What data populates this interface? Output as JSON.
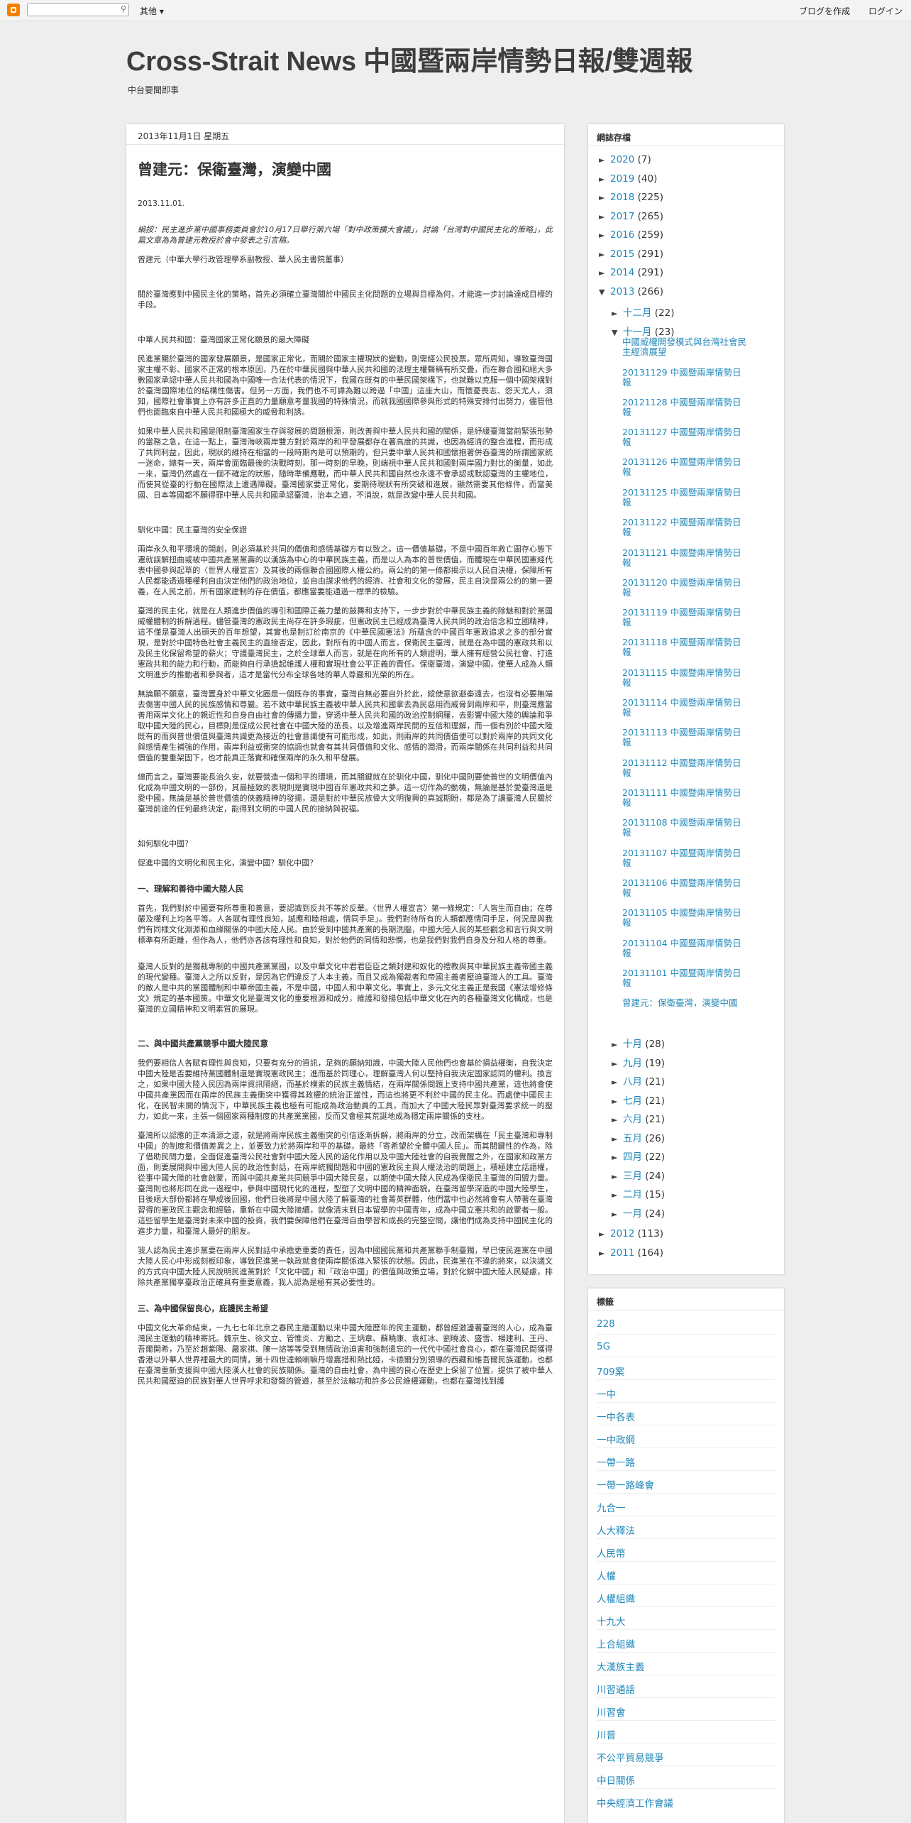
{
  "navbar": {
    "more": "其他 ▾",
    "create_blog": "ブログを作成",
    "login": "ログイン"
  },
  "header": {
    "title": "Cross-Strait News 中國暨兩岸情勢日報/雙週報",
    "description": "中台要聞即事"
  },
  "post": {
    "date": "2013年11月1日 星期五",
    "title": "曾建元：保衛臺灣，演變中國",
    "pub_date": "2013.11.01.",
    "editor_note": "編按：民主進步黨中國事務委員會於10月17日舉行第六場「對中政策擴大會議」，討論「台灣對中國民主化的策略」，此篇文章為為曾建元教授於會中發表之引言稿。",
    "author": "曾建元（中華大學行政管理學系副教授、華人民主書院董事）",
    "p_intro": "關於臺灣應對中國民主化的策略，首先必須確立臺灣關於中國民主化問題的立場與目標為何，才能進一步討論達成目標的手段。",
    "h_zhongha": "中華人民共和國：臺灣國家正常化願景的最大障礙",
    "p1": "民進黨關於臺灣的國家發展願景，是國家正常化，而關於國家主權現狀的變動，則需經公民投票。眾所周知，導致臺灣國家主權不彰、國家不正常的根本原因，乃在於中華民國與中華人民共和國的法理主權聲稱有所交疊，而在聯合國和絕大多數國家承認中華人民共和國為中國唯一合法代表的情況下，我國在既有的中華民國架構下，也就難以克服一個中國架構對於臺灣國際地位的結構性傷害。但另一方面，我們也不可諱為難以跨過「中國」這座大山，而懷憂喪志、怨天尤人，須知，國際社會事實上亦有許多正直的力量願意考量我國的特殊情況，而就我國國際參與形式的特殊安排付出努力，儘管他們也面臨來自中華人民共和國極大的威脅和利誘。",
    "p2": "如果中華人民共和國是限制臺灣國家生存與發展的問題根源，則改善與中華人民共和國的關係，是紓緩臺灣當前緊張形勢的當務之急，在這一點上，臺灣海峽兩岸雙方對於兩岸的和平發展都存在著高度的共識，也因為經濟的整合進程，而形成了共同利益，因此，現狀的維持在相當的一段時期內是可以預期的，但只要中華人民共和國懷抱著併吞臺灣的所謂國家統一迷命，總有一天，兩岸會面臨最後的決戰時刻，那一時刻的早晚，則端視中華人民共和國對兩岸國力對比的衡量，如此一來，臺灣仍然處在一個不確定的狀態，隨時準備應戰，而中華人民共和國自然也永遠不會承認或默認臺灣的主權地位，而使其從臺的行動在國際法上遭遇障礙。臺灣國家要正常化，要期待現狀有所突破和進展，顯然需要其他條件，而當美國、日本等國都不願得罪中華人民共和國承認臺灣，治本之道，不消說，就是改變中華人民共和國。",
    "h_tame": "馴化中國：民主臺灣的安全保證",
    "p3": "兩岸永久和平環境的開創，則必須基於共同的價值和感情基礎方有以致之。這一價值基礎，不是中國百年救亡圖存心態下遷就誤解扭曲或被中國共產黨黨壽的以漢族為中心的中華民族主義，而是以人為本的普世價值，而體現在中華民國憲經代表中國參與起草的〈世界人權宣言〉及其後的兩個聯合國國際人權公約。兩公約的第一條都揭示以人民自決權，保障所有人民都能透過種權利自由決定他們的政治地位，並自由謀求他們的經濟、社會和文化的發展，民主自決是兩公約的第一要義，在人民之前，所有國家建制的存在價值，都應當要能通過一標準的檢驗。",
    "p4": "臺灣的民主化，就是在人類進步價值的導引和國際正義力量的鼓舞和支持下，一步步對於中華民族主義的除魅和對於黨國威權體制的拆解過程。儘管臺灣的憲政民主尚存在許多瑕疵，但憲政民主已經成為臺灣人民共同的政治信念和立國精神，這不僅是臺灣人出頭天的百年想望，其實也是制訂於南京的《中華民國憲法》所蘊含的中國百年憲政追求之多的部分實現，是對於中國特色社會主義民主的直接否定，因此，對所有的中國人而言，保衛民主臺灣，就是在為中國的憲政共和以及民主化保留希望的薪火；守護臺灣民主，之於全球華人而言，就是在向所有的人類證明，華人擁有經營公民社會、打造憲政共和的能力和行動，而能夠自行承擔起維護人權和實現社會公平正義的責任。保衛臺灣，演變中國，使華人成為人類文明進步的推動者和參與者，這才是當代分布全球各地的華人尊嚴和光榮的所在。",
    "p5": "無論願不願意，臺灣置身於中華文化圈是一個既存的事實，臺灣自無必要自外於此，縱使意欲避秦遠去，也沒有必要無端去傷害中國人民的民族感情和尊嚴。若不致中華民族主義被中華人民共和國拿去為民惡用而威脅到兩岸和平，則臺灣應當善用兩岸文化上的親近性和自身自由社會的傳播力量，穿透中華人民共和國的政治控制網羅，去影響中國大陸的輿論和爭取中國大陸的民心，目標則是促成公民社會在中國大陸的茁長，以及增進兩岸民間的互信和理解，而一個有別於中國大陸既有的而與普世價值與臺灣共識更為接近的社會意識便有可能形成，如此，則兩岸的共同價值便可以對於兩岸的共同文化與感情產生補強的作用，兩岸利益或衝突的協調也就會有其共同價值和文化、感情的潤滑，而兩岸關係在共同利益和共同價值的雙重架固下，也才能真正落實和確保兩岸的永久和平發展。",
    "p6": "總而言之，臺灣要能長治久安，就要營造一個和平的環境，而其關鍵就在於馴化中國，馴化中國則要使普世的文明價值內化成為中國文明的一部份，其最極致的表現則是實現中國百年憲政共和之夢。這一切作為的動機，無論是基於愛臺灣還是愛中國，無論是基於普世價值的俠義精神的發揚，還是對於中華民族偉大文明復興的真誠期盼，都是為了讓臺灣人民關於臺灣前途的任何最終決定，能得到文明的中國人民的接納與祝福。",
    "h_how": "如何馴化中國？",
    "q_how": "促進中國的文明化和民主化，演變中國？馴化中國？",
    "h_one": "一、理解和善待中國大陸人民",
    "p7": "首先，我們對於中國要有所尊重和善意，要認識到反共不等於反華。〈世界人權宣言〉第一條規定：「人皆生而自由；在尊嚴及權利上均各平等。人各賦有理性良知，誠應和睦相處，情同手足」。我們對待所有的人類都應情同手足，何況是與我們有同樣文化淵源和血緣關係的中國大陸人民。由於受到中國共產黨的長期洗腦，中國大陸人民的某些觀念和言行與文明標準有所距離，但作為人，他們亦各該有理性和良知，對於他們的同情和悲憫，也是我們對我們自身及分和人格的尊重。",
    "p8": "臺灣人反對的是獨裁專制的中國共產黨黨國，以及中華文化中君君臣臣之類封建和奴化的禮教與其中華民族主義帝國主義的現代變種。臺灣人之所以反對，是因為它們違反了人本主義，而且又成為獨裁者和帝國主義者壓迫臺灣人的工具。臺灣的敵人是中共的黨國體制和中華帝國主義，不是中國，中國人和中華文化。事實上，多元文化主義正是我國《憲法增修條文》規定的基本國策。中華文化是臺灣文化的重要根源和成分，維護和發揚包括中華文化在內的各種臺灣文化構成，也是臺灣的立國精神和文明素質的展現。",
    "h_two": "二、與中國共產黨競爭中國大陸民意",
    "p9": "我們要相信人各賦有理性與良知，只要有充分的資訊，足夠的願納知識，中國大陸人民他們也會基於損益權衡，自我決定中國大陸是否要維持黨國體制還是實現憲政民主；進而基於同理心，理解臺灣人何以堅持自我決定國家認同的權利。換言之，如果中國大陸人民因為兩岸資訊隔絕，而基於樸素的民族主義情結，在兩岸關係問題上支持中國共產黨，這也將會使中國共產黨因而在兩岸的民族主義衝突中獲得其政權的統治正當性，而這也將更不利於中國的民主化。而處使中國民主化，在民智未開的情況下，中華民族主義也極有可能成為政治動員的工具，而加大了中國大陸民眾對臺灣要求統一的壓力，如此一來，主張一個國家兩種制度的共產黨黨國，反而又會極其荒誕地成為穩定兩岸關係的支柱。",
    "p10": "臺灣所以認應的正本清源之道，就是將兩岸民族主義衝突的引信逐漸拆解，將兩岸的分立，改而架構在「民主臺灣和專制中國」的制度和價值差異之上，並要致力於將兩岸和平的基礎，最終「寄希望於全體中國人民」。而其關鍵性的作為，除了借助民間力量，全面促進臺灣公民社會對中國大陸人民的涵化作用以及中國大陸社會的自我覺醒之外，在國家和政黨方面，則要展開與中國大陸人民的政治性對話，在兩岸統獨問題和中國的憲政民主與人權法治的問題上，積極建立話語權，從事中國大陸的社會啟蒙，而與中國共產黨共同競爭中國大陸民意，以期使中國大陸人民成為保衛民主臺灣的同盟力量。臺灣則也將形同在此一過程中，參與中國現代化的進程，型塑了文明中國的精神面貌。在臺灣留學深造的中國大陸學生，日後絕大部份都將在學成後回國，他們日後將是中國大陸了解臺灣的社會菁英群體，他們當中也必然將會有人帶著在臺灣習得的憲政民主觀念和經驗，重新在中國大陸接續，就像清末到日本留學的中國青年，成為中國立憲共和的啟蒙者一般。這些留學生是臺灣對未來中國的投資，我們要保障他們在臺灣自由學習和成長的完整空間，讓他們成為支持中國民主化的進步力量，和臺灣人最好的朋友。",
    "p11": "我人認為民主進步黨要在兩岸人民對話中承擔更重要的責任，因為中國國民黨和共產黨聯手制臺獨，早已使民進黨在中國大陸人民心中形成刻板印象，導致民進黨一執政就會使兩岸關係進入緊張的狀態。因此，民進黨在不違的將來，以決議文的方式向中國大陸人民說明民進黨對於「文化中國」和「政治中國」的價值與政策立場，對於化解中國大陸人民疑慮，排除共產黨獨享臺政治正確具有重要意義，我人認為是極有其必要性的。",
    "h_three": "三、為中國保留良心，庇護民主希望",
    "p12": "中國文化大革命結束，一九七七年北京之春民主牆運動以來中國大陸歷年的民主運動，都曾經激盪著臺灣的人心，成為臺灣民主運動的精神寄託。魏京生、徐文立、管惟炎、方勵之、王炳章、蘇曉康、袁紅冰、劉曉波、盛雪、楊建利、王丹、吾爾開希，乃至於趙紫陽、嚴家祺、陳一諮等等受到無情政治迫害和強制遣忘的一代代中國社會良心，都在臺灣民間獲得香港以外華人世界裡最大的同情，第十四世達賴喇嘛丹增嘉措和熱比婭，卡德爾分別領導的西藏和維吾爾民族運動，也都在臺灣重新支援與中國大陸漢人社會的民族關係。臺灣的自由社會，為中國的良心在歷史上保留了位置，提供了被中華人民共和國壓迫的民族對華人世界呼求和發聲的管道，甚至於法輪功和許多公民維權運動，也都在臺灣找到護"
  },
  "archive": {
    "heading": "網誌存檔",
    "years": [
      {
        "label": "2020",
        "count": "(7)"
      },
      {
        "label": "2019",
        "count": "(40)"
      },
      {
        "label": "2018",
        "count": "(225)"
      },
      {
        "label": "2017",
        "count": "(265)"
      },
      {
        "label": "2016",
        "count": "(259)"
      },
      {
        "label": "2015",
        "count": "(291)"
      },
      {
        "label": "2014",
        "count": "(291)"
      },
      {
        "label": "2013",
        "count": "(266)"
      }
    ],
    "months_2013_top": [
      {
        "label": "十二月",
        "count": "(22)"
      },
      {
        "label": "十一月",
        "count": "(23)"
      }
    ],
    "november_posts": [
      "中國威權開發模式與台灣社會民主經濟展望",
      "20131129 中國暨兩岸情勢日報",
      "20121128 中國暨兩岸情勢日報",
      "20131127 中國暨兩岸情勢日報",
      "20131126 中國暨兩岸情勢日報",
      "20131125 中國暨兩岸情勢日報",
      "20131122 中國暨兩岸情勢日報",
      "20131121 中國暨兩岸情勢日報",
      "20131120 中國暨兩岸情勢日報",
      "20131119 中國暨兩岸情勢日報",
      "20131118 中國暨兩岸情勢日報",
      "20131115 中國暨兩岸情勢日報",
      "20131114 中國暨兩岸情勢日報",
      "20131113 中國暨兩岸情勢日報",
      "20131112 中國暨兩岸情勢日報",
      "20131111 中國暨兩岸情勢日報",
      "20131108 中國暨兩岸情勢日報",
      "20131107 中國暨兩岸情勢日報",
      "20131106 中國暨兩岸情勢日報",
      "20131105 中國暨兩岸情勢日報",
      "20131104 中國暨兩岸情勢日報",
      "20131101 中國暨兩岸情勢日報",
      "曾建元：保衛臺灣，演變中國"
    ],
    "months_2013_rest": [
      {
        "label": "十月",
        "count": "(28)"
      },
      {
        "label": "九月",
        "count": "(19)"
      },
      {
        "label": "八月",
        "count": "(21)"
      },
      {
        "label": "七月",
        "count": "(21)"
      },
      {
        "label": "六月",
        "count": "(21)"
      },
      {
        "label": "五月",
        "count": "(26)"
      },
      {
        "label": "四月",
        "count": "(22)"
      },
      {
        "label": "三月",
        "count": "(24)"
      },
      {
        "label": "二月",
        "count": "(15)"
      },
      {
        "label": "一月",
        "count": "(24)"
      }
    ],
    "years_after": [
      {
        "label": "2012",
        "count": "(113)"
      },
      {
        "label": "2011",
        "count": "(164)"
      }
    ]
  },
  "labels": {
    "heading": "標籤",
    "items": [
      "228",
      "5G",
      "709案",
      "一中",
      "一中各表",
      "一中政綱",
      "一帶一路",
      "一帶一路峰會",
      "九合一",
      "人大釋法",
      "人民幣",
      "人權",
      "人權組織",
      "十九大",
      "上合組織",
      "大漢族主義",
      "川習通話",
      "川習會",
      "川普",
      "不公平貿易競爭",
      "中日關係",
      "中央經濟工作會議"
    ]
  }
}
